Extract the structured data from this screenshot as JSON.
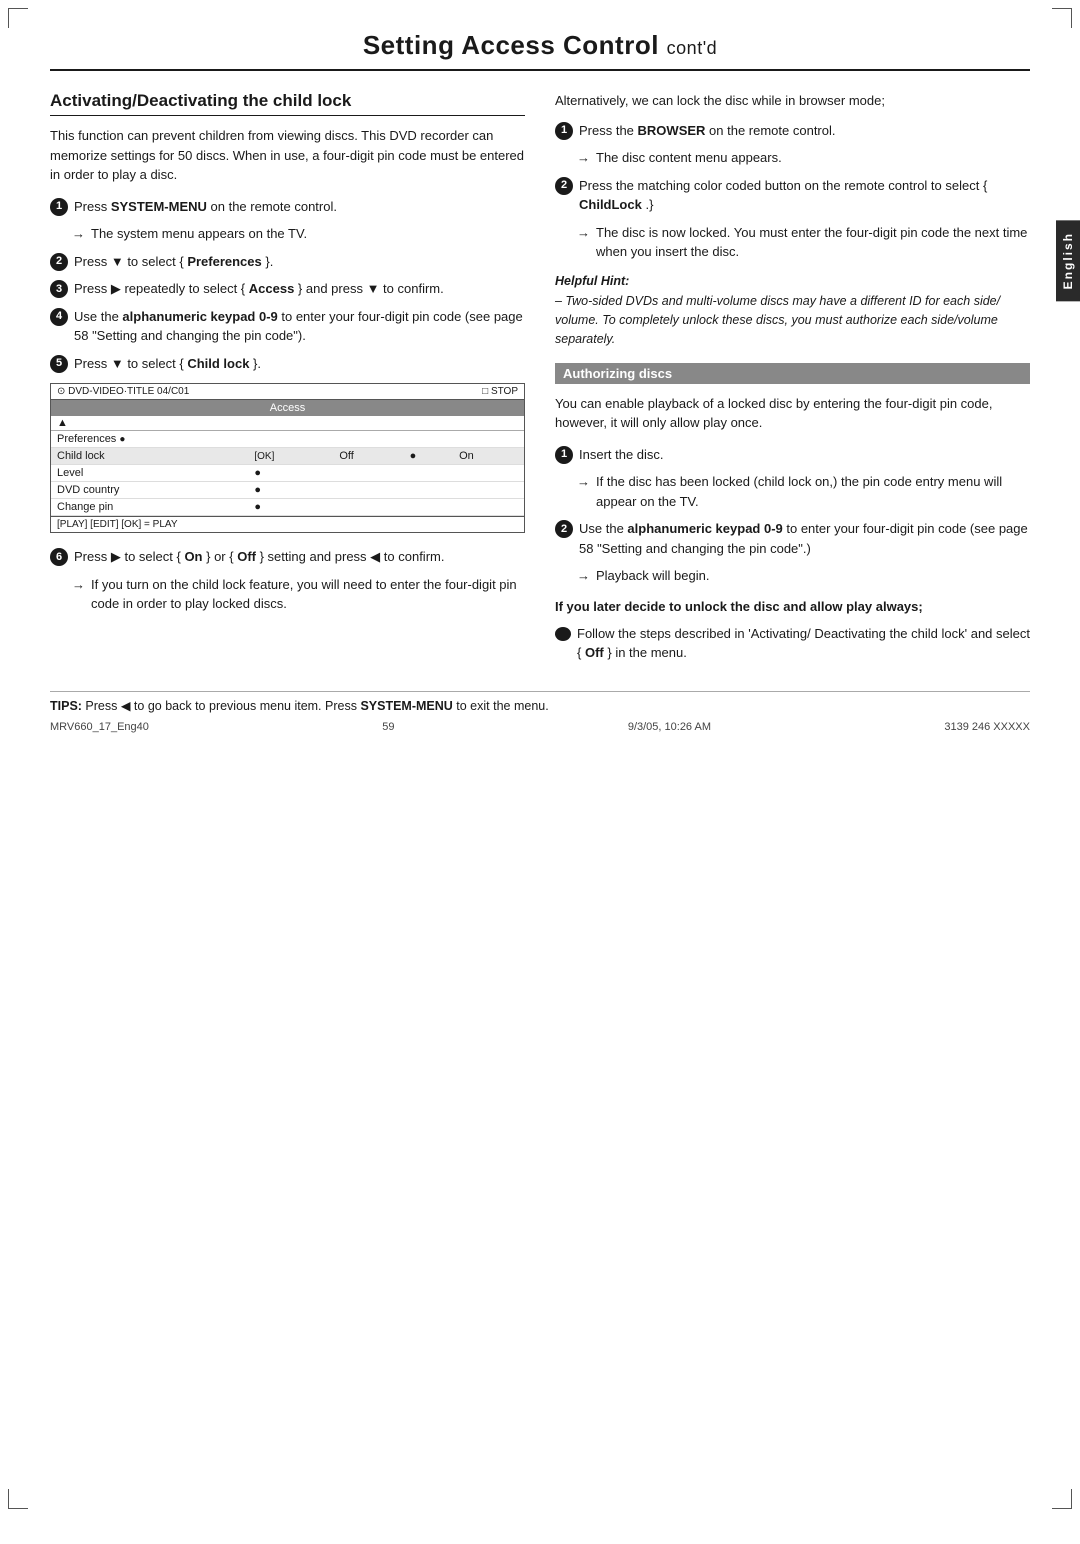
{
  "page": {
    "title": "Setting Access Control",
    "title_contd": "cont'd",
    "english_tab": "English"
  },
  "left_col": {
    "section_heading": "Activating/Deactivating the child lock",
    "intro_text": "This function can prevent children from viewing discs. This DVD recorder can memorize settings for 50 discs. When in use, a four-digit pin code must be entered in order to play a disc.",
    "steps": [
      {
        "number": "1",
        "text_html": "Press <b>SYSTEM-MENU</b> on the remote control."
      },
      {
        "number": "1",
        "arrow": true,
        "text": "The system menu appears on the TV."
      },
      {
        "number": "2",
        "text_html": "Press ▼ to select { <b>Preferences</b> }."
      },
      {
        "number": "3",
        "text_html": "Press ▶ repeatedly to select { <b>Access</b> } and press ▼ to confirm."
      },
      {
        "number": "4",
        "text_html": "Use the <b>alphanumeric keypad 0-9</b> to enter your four-digit pin code (see page 58 \"Setting and changing the pin code\")."
      },
      {
        "number": "5",
        "text_html": "Press ▼ to select { <b>Child lock</b> }."
      }
    ],
    "screen": {
      "top_left": "DVD-VIDEO·TITLE 04/C01",
      "top_right": "■ STOP",
      "access_label": "Access",
      "arrow_label": "▲",
      "preferences_label": "Preferences",
      "pref_dot": "●",
      "rows": [
        {
          "label": "Child lock",
          "selected": true,
          "value_left": "Off",
          "dot": "●",
          "value_right": "On"
        },
        {
          "label": "Level",
          "dot": "●"
        },
        {
          "label": "DVD country",
          "dot": "●"
        },
        {
          "label": "Change pin",
          "dot": "●"
        }
      ],
      "bottom_bar": "[PLAY] [EDIT] [OK] = PLAY"
    },
    "step6": {
      "text_html": "Press ▶ to select { <b>On</b> } or { <b>Off</b> } setting and press ◀ to confirm."
    },
    "step6_note": "→ If you turn on the child lock feature, you will need to enter the four-digit pin code in order to play locked discs."
  },
  "right_col": {
    "alt_intro": "Alternatively, we can lock the disc while in browser mode;",
    "steps_alt": [
      {
        "number": "1",
        "text_html": "Press the <b>BROWSER</b> on the remote control."
      },
      {
        "number": "1",
        "arrow": true,
        "text": "The disc content menu appears."
      },
      {
        "number": "2",
        "text_html": "Press the matching color coded button on the remote control to select { <b>ChildLock</b> .}"
      },
      {
        "number": "2",
        "arrow": true,
        "text": "The disc is now locked. You must enter the four-digit pin code the next time when you insert the disc."
      }
    ],
    "helpful_hint_title": "Helpful Hint:",
    "helpful_hint_body": "– Two-sided DVDs and multi-volume discs may have a different ID for each side/ volume. To completely unlock these discs, you must authorize each side/volume separately.",
    "auth_section": {
      "heading": "Authorizing discs",
      "intro": "You can enable playback of a locked disc by entering the four-digit pin code, however, it will only allow play once.",
      "steps": [
        {
          "number": "1",
          "text": "Insert the disc."
        },
        {
          "number": "1",
          "arrow": true,
          "text": "If the disc has been locked (child lock on,) the pin code entry menu will appear on the TV."
        },
        {
          "number": "2",
          "text_html": "Use the <b>alphanumeric keypad 0-9</b> to enter your four-digit pin code (see page 58 \"Setting and changing the pin code\".) → Playback will begin."
        }
      ],
      "bold_heading": "If you later decide to unlock the disc and allow play always;",
      "last_step_html": "Follow the steps described in 'Activating/ Deactivating the child lock' and select { <b>Off</b> } in the menu."
    }
  },
  "tips": {
    "label": "TIPS:",
    "text_html": "Press ◀ to go back to previous menu item. Press <b>SYSTEM-MENU</b> to exit the menu."
  },
  "footer": {
    "left": "MRV660_17_Eng40",
    "center": "59",
    "right_date": "9/3/05, 10:26 AM",
    "right_doc": "3139 246 XXXXX"
  },
  "page_number": "59"
}
